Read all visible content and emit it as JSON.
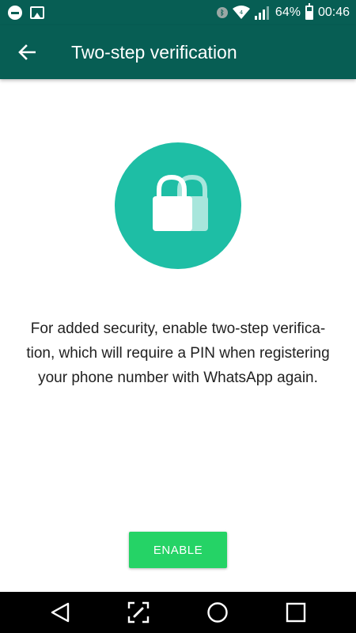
{
  "status_bar": {
    "battery_percent": "64%",
    "battery_level": 0.64,
    "time": "00:46",
    "icons": [
      "dnd-icon",
      "gallery-icon",
      "bluetooth-icon",
      "wifi-icon",
      "signal-icon",
      "battery-icon"
    ]
  },
  "app_bar": {
    "back_icon": "arrow-left-icon",
    "title": "Two-step verification",
    "color": "#075e54"
  },
  "main": {
    "hero_icon": "lock-icon",
    "hero_color": "#1ebea5",
    "description_lines": [
      "For added security, enable two-step verifica-",
      "tion, which will require a PIN when registering",
      "your phone number with WhatsApp again."
    ],
    "enable_label": "ENABLE",
    "enable_color": "#25d366"
  },
  "nav_bar": {
    "buttons": [
      "back-triangle-icon",
      "edit-capture-icon",
      "home-circle-icon",
      "recents-square-icon"
    ]
  }
}
